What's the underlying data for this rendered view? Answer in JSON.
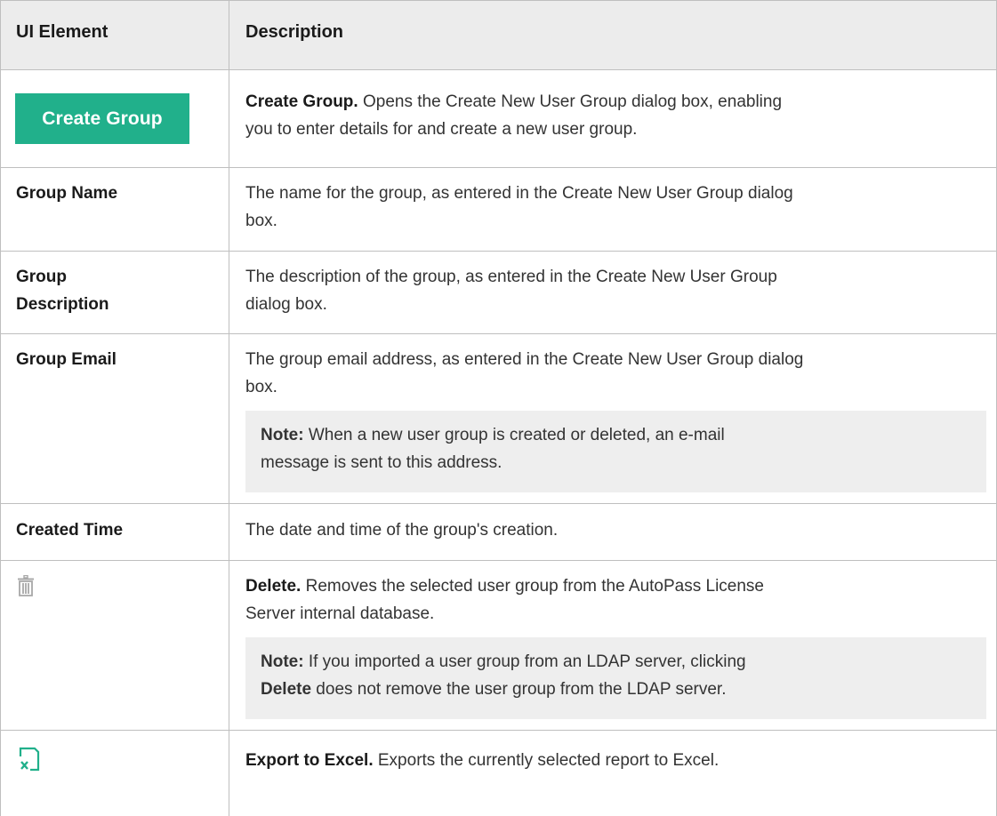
{
  "header": {
    "col1": "UI Element",
    "col2": "Description"
  },
  "rows": {
    "create_group": {
      "button_label": "Create Group",
      "desc_bold": "Create Group.",
      "desc_line1": " Opens the Create New User Group dialog box, enabling",
      "desc_line2": "you to enter details for and create a new user group."
    },
    "group_name": {
      "label": "Group Name",
      "desc_line1": "The name for the group, as entered in the Create New User Group dialog",
      "desc_line2": "box."
    },
    "group_description": {
      "label_line1": "Group",
      "label_line2": "Description",
      "desc_line1": "The description of the group, as entered in the Create New User Group",
      "desc_line2": "dialog box."
    },
    "group_email": {
      "label": "Group Email",
      "desc_line1": "The group email address, as entered in the Create New User Group dialog",
      "desc_line2": "box.",
      "note_bold": "Note:",
      "note_line1": " When a new user group is created or deleted, an e-mail",
      "note_line2": "message is sent to this address."
    },
    "created_time": {
      "label": "Created Time",
      "desc": "The date and time of the group's creation."
    },
    "delete": {
      "icon": "trash-icon",
      "desc_bold": "Delete.",
      "desc_line1": " Removes the selected user group from the AutoPass License",
      "desc_line2": "Server internal database.",
      "note_bold": "Note:",
      "note_line1": " If you imported a user group from an LDAP server, clicking",
      "note_line2_bold": "Delete",
      "note_line2": " does not remove the user group from the LDAP server."
    },
    "export": {
      "icon": "excel-export-icon",
      "desc_bold": "Export to Excel.",
      "desc": " Exports the currently selected report to Excel."
    }
  },
  "colors": {
    "accent": "#21b08b",
    "header_bg": "#ececec",
    "note_bg": "#eeeeee",
    "border": "#bfbfbf"
  }
}
